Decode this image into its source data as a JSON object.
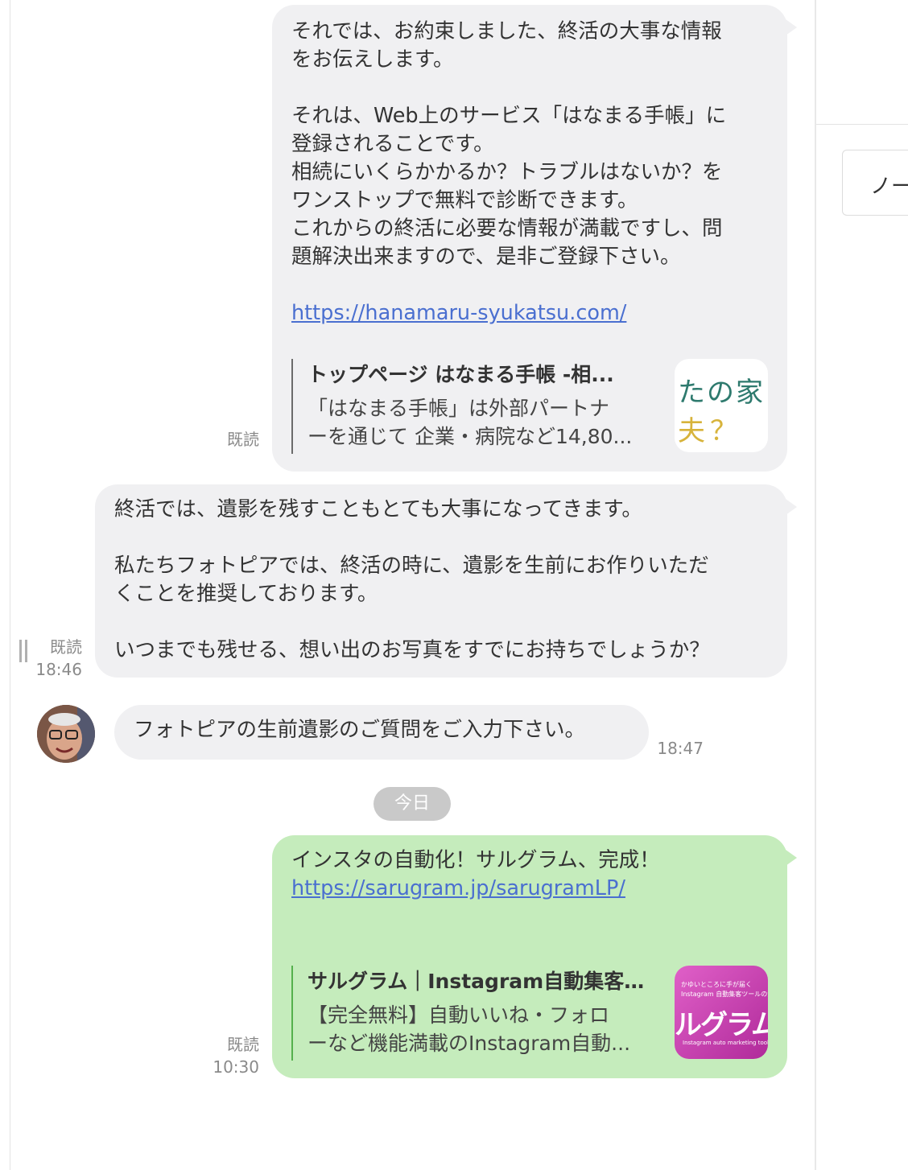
{
  "messages": [
    {
      "id": "msg1",
      "lines": [
        "それでは、お約束しました、終活の大事な情報",
        "をお伝えします。",
        "",
        "それは、Web上のサービス「はなまる手帳」に",
        "登録されることです。",
        "相続にいくらかかるか？トラブルはないか？を",
        "ワンストップで無料で診断できます。",
        "これからの終活に必要な情報が満載ですし、問",
        "題解決出来ますので、是非ご登録下さい。"
      ],
      "link": "https://hanamaru-syukatsu.com/",
      "preview": {
        "title": "トップページ はなまる手帳 -相...",
        "desc_line1": "「はなまる手帳」は外部パートナ",
        "desc_line2": "ーを通じて 企業・病院など14,80...",
        "thumb_text_line1": "たの家",
        "thumb_text_line2": "夫？"
      },
      "status": "既読"
    },
    {
      "id": "msg2",
      "lines": [
        "終活では、遺影を残すこともとても大事になってきます。",
        "",
        "私たちフォトピアでは、終活の時に、遺影を生前にお作りいただ",
        "くことを推奨しております。",
        "",
        "いつまでも残せる、想い出のお写真をすでにお持ちでしょうか？"
      ],
      "status": "既読",
      "time": "18:46"
    },
    {
      "id": "msg3",
      "text": "フォトピアの生前遺影のご質問をご入力下さい。",
      "time": "18:47"
    },
    {
      "id": "msg4",
      "line1": "インスタの自動化！サルグラム、完成！",
      "link": "https://sarugram.jp/sarugramLP/",
      "preview": {
        "title": "サルグラム｜Instagram自動集客...",
        "desc_line1": "【完全無料】自動いいね・フォロ",
        "desc_line2": "ーなど機能満載のInstagram自動...",
        "thumb_small_1": "かゆいところに手が届く",
        "thumb_small_2": "Instagram 自動集客ツールの決",
        "thumb_big": "ルグラム",
        "thumb_caption": "Instagram auto marketing tool"
      },
      "status": "既読",
      "time": "10:30"
    }
  ],
  "date_separator": "今日",
  "right_panel": {
    "note_label": "ノー"
  },
  "colors": {
    "incoming_bubble": "#f0f0f2",
    "outgoing_bubble": "#c5ecbc",
    "link": "#4a6fd0",
    "date_pill": "#c9c9c9"
  }
}
